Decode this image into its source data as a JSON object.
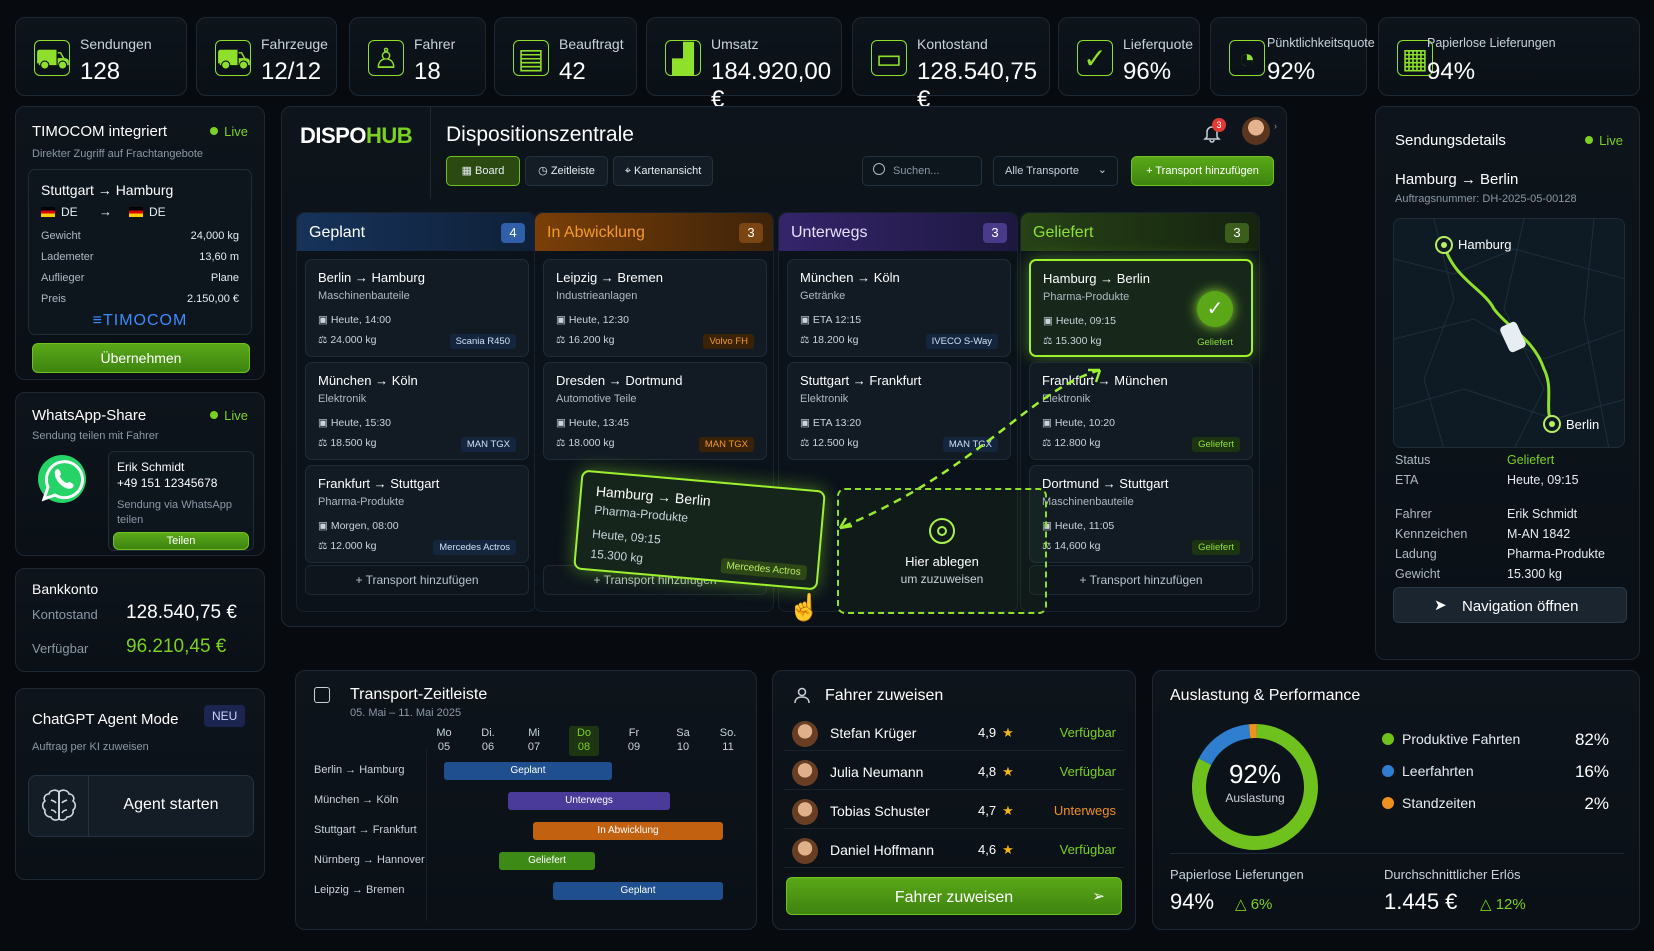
{
  "kpis": [
    {
      "label": "Sendungen",
      "value": "128",
      "icon": "truck-icon"
    },
    {
      "label": "Fahrzeuge",
      "value": "12/12",
      "icon": "truck-icon"
    },
    {
      "label": "Fahrer",
      "value": "18",
      "icon": "user-icon"
    },
    {
      "label": "Beauftragt",
      "value": "42",
      "icon": "clipboard-icon"
    },
    {
      "label": "Umsatz",
      "value": "184.920,00 €",
      "icon": "chart-icon"
    },
    {
      "label": "Kontostand",
      "value": "128.540,75 €",
      "icon": "wallet-icon"
    },
    {
      "label": "Lieferquote",
      "value": "96%",
      "icon": "check-circle-icon"
    },
    {
      "label": "Pünktlichkeitsquote",
      "value": "92%",
      "icon": "gauge-icon"
    },
    {
      "label": "Papierlose Lieferungen",
      "value": "94%",
      "icon": "document-icon"
    }
  ],
  "timocom": {
    "title": "TIMOCOM integriert",
    "live": "Live",
    "subtitle": "Direkter Zugriff auf Frachtangebote",
    "route": "Stuttgart → Hamburg",
    "from_country": "DE",
    "arrow": "→",
    "to_country": "DE",
    "rows": [
      [
        "Gewicht",
        "24,000 kg"
      ],
      [
        "Lademeter",
        "13,60 m"
      ],
      [
        "Auflieger",
        "Plane"
      ],
      [
        "Preis",
        "2.150,00 €"
      ]
    ],
    "brand": "TIMOCOM",
    "button": "Übernehmen"
  },
  "whatsapp": {
    "title": "WhatsApp-Share",
    "live": "Live",
    "subtitle": "Sendung teilen mit Fahrer",
    "name": "Erik Schmidt",
    "phone": "+49 151 12345678",
    "note": "Sendung via WhatsApp teilen",
    "button": "Teilen"
  },
  "bank": {
    "title": "Bankkonto",
    "bal_label": "Kontostand",
    "bal_value": "128.540,75 €",
    "avail_label": "Verfügbar",
    "avail_value": "96.210,45 €"
  },
  "agent": {
    "title": "ChatGPT Agent Mode",
    "badge": "NEU",
    "subtitle": "Auftrag per KI zuweisen",
    "button": "Agent starten"
  },
  "header": {
    "logo_a": "DISPO",
    "logo_b": "HUB",
    "title": "Dispositionszentrale",
    "notif_count": "3",
    "tabs": [
      "Board",
      "Zeitleiste",
      "Kartenansicht"
    ],
    "search_placeholder": "Suchen...",
    "filter": "Alle Transporte",
    "add_button": "Transport hinzufügen"
  },
  "board": {
    "add_label": "+ Transport hinzufügen",
    "columns": [
      {
        "name": "Geplant",
        "count": "4",
        "cards": [
          {
            "route": "Berlin → Hamburg",
            "cargo": "Maschinenbauteile",
            "time": "Heute, 14:00",
            "weight": "24.000 kg",
            "tag": "Scania R450"
          },
          {
            "route": "München → Köln",
            "cargo": "Elektronik",
            "time": "Heute, 15:30",
            "weight": "18.500 kg",
            "tag": "MAN TGX"
          },
          {
            "route": "Frankfurt → Stuttgart",
            "cargo": "Pharma-Produkte",
            "time": "Morgen, 08:00",
            "weight": "12.000 kg",
            "tag": "Mercedes Actros"
          }
        ]
      },
      {
        "name": "In Abwicklung",
        "count": "3",
        "cards": [
          {
            "route": "Leipzig → Bremen",
            "cargo": "Industrieanlagen",
            "time": "Heute, 12:30",
            "weight": "16.200 kg",
            "tag": "Volvo FH"
          },
          {
            "route": "Dresden → Dortmund",
            "cargo": "Automotive Teile",
            "time": "Heute, 13:45",
            "weight": "18.000 kg",
            "tag": "MAN TGX"
          }
        ]
      },
      {
        "name": "Unterwegs",
        "count": "3",
        "cards": [
          {
            "route": "München → Köln",
            "cargo": "Getränke",
            "time": "ETA 12:15",
            "weight": "18.200 kg",
            "tag": "IVECO S-Way"
          },
          {
            "route": "Stuttgart → Frankfurt",
            "cargo": "Elektronik",
            "time": "ETA 13:20",
            "weight": "12.500 kg",
            "tag": "MAN TGX"
          }
        ]
      },
      {
        "name": "Geliefert",
        "count": "3",
        "cards": [
          {
            "route": "Hamburg → Berlin",
            "cargo": "Pharma-Produkte",
            "time": "Heute, 09:15",
            "weight": "15.300 kg",
            "tag": "Geliefert"
          },
          {
            "route": "Frankfurt → München",
            "cargo": "Elektronik",
            "time": "Heute, 10:20",
            "weight": "12.800 kg",
            "tag": "Geliefert"
          },
          {
            "route": "Dortmund → Stuttgart",
            "cargo": "Maschinenbauteile",
            "time": "Heute, 11:05",
            "weight": "14,600 kg",
            "tag": "Geliefert"
          }
        ]
      }
    ],
    "drag": {
      "route": "Hamburg → Berlin",
      "cargo": "Pharma-Produkte",
      "time": "Heute, 09:15",
      "weight": "15.300 kg",
      "tag": "Mercedes Actros"
    },
    "drop_title": "Hier ablegen",
    "drop_sub": "um zuzuweisen"
  },
  "details": {
    "title": "Sendungsdetails",
    "live": "Live",
    "route": "Hamburg → Berlin",
    "order": "Auftragsnummer: DH-2025-05-00128",
    "map_from": "Hamburg",
    "map_to": "Berlin",
    "rows": [
      [
        "Status",
        "Geliefert"
      ],
      [
        "ETA",
        "Heute, 09:15"
      ],
      [
        "Fahrer",
        "Erik Schmidt"
      ],
      [
        "Kennzeichen",
        "M-AN 1842"
      ],
      [
        "Ladung",
        "Pharma-Produkte"
      ],
      [
        "Gewicht",
        "15.300 kg"
      ]
    ],
    "button": "Navigation öffnen"
  },
  "timeline": {
    "title": "Transport-Zeitleiste",
    "range": "05. Mai – 11. Mai 2025",
    "days": [
      [
        "Mo",
        "05"
      ],
      [
        "Di.",
        "06"
      ],
      [
        "Mi",
        "07"
      ],
      [
        "Do",
        "08"
      ],
      [
        "Fr",
        "09"
      ],
      [
        "Sa",
        "10"
      ],
      [
        "So.",
        "11"
      ]
    ],
    "rows": [
      {
        "route": "Berlin → Hamburg",
        "status": "Geplant"
      },
      {
        "route": "München → Köln",
        "status": "Unterwegs"
      },
      {
        "route": "Stuttgart → Frankfurt",
        "status": "In Abwicklung"
      },
      {
        "route": "Nürnberg → Hannover",
        "status": "Geliefert"
      },
      {
        "route": "Leipzig → Bremen",
        "status": "Geplant"
      }
    ]
  },
  "drivers": {
    "title": "Fahrer zuweisen",
    "button": "Fahrer zuweisen",
    "list": [
      {
        "name": "Stefan Krüger",
        "rating": "4,9",
        "status": "Verfügbar"
      },
      {
        "name": "Julia Neumann",
        "rating": "4,8",
        "status": "Verfügbar"
      },
      {
        "name": "Tobias Schuster",
        "rating": "4,7",
        "status": "Unterwegs"
      },
      {
        "name": "Daniel Hoffmann",
        "rating": "4,6",
        "status": "Verfügbar"
      }
    ]
  },
  "performance": {
    "title": "Auslastung & Performance",
    "center_value": "92%",
    "center_label": "Auslastung",
    "legend": [
      {
        "label": "Produktive Fahrten",
        "value": "82%",
        "color": "#6fc21d"
      },
      {
        "label": "Leerfahrten",
        "value": "16%",
        "color": "#2f7fd0"
      },
      {
        "label": "Standzeiten",
        "value": "2%",
        "color": "#f0901e"
      }
    ],
    "paper_label": "Papierlose Lieferungen",
    "paper_value": "94%",
    "paper_delta": "△ 6%",
    "rev_label": "Durchschnittlicher Erlös",
    "rev_value": "1.445 €",
    "rev_delta": "△ 12%"
  },
  "chart_data": {
    "type": "pie",
    "title": "Auslastung & Performance",
    "categories": [
      "Produktive Fahrten",
      "Leerfahrten",
      "Standzeiten"
    ],
    "values": [
      82,
      16,
      2
    ]
  }
}
